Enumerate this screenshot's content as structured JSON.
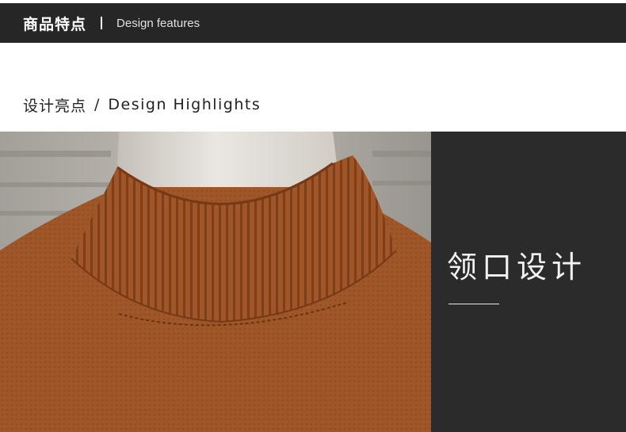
{
  "header": {
    "title_cn": "商品特点",
    "title_en": "Design features"
  },
  "section": {
    "title_cn": "设计亮点",
    "separator": "/",
    "title_en": "Design Highlights"
  },
  "feature_panel": {
    "title": "领口设计"
  },
  "colors": {
    "bar_background": "#262626",
    "panel_background": "#2b2b2b",
    "sweater": "#a2582a"
  }
}
